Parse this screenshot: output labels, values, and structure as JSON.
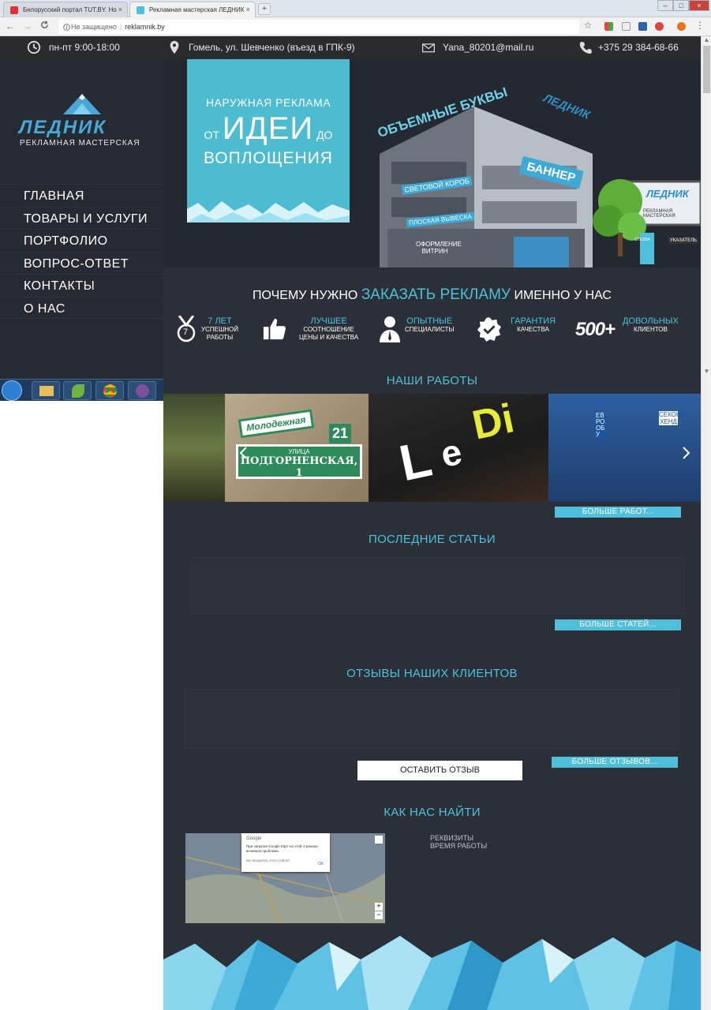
{
  "browser": {
    "tabs": [
      {
        "label": "Белорусский портал TUT.BY. Но",
        "close": "×"
      },
      {
        "label": "Рекламная мастерская ЛЕДНИК",
        "close": "×"
      }
    ],
    "new_tab": "+",
    "nav": {
      "back": "←",
      "forward": "→",
      "reload": "C"
    },
    "address": {
      "security": "Не защищено",
      "url": "reklamnik.by"
    },
    "bookmark_star": "☆",
    "menu_dots": "⋮"
  },
  "topbar": {
    "hours": "пн-пт 9:00-18:00",
    "address": "Гомель, ул. Шевченко (въезд в ГПК-9)",
    "email": "Yana_80201@mail.ru",
    "phone_prefix": "+375 29",
    "phone_number": "384-68-66"
  },
  "logo": {
    "name": "ЛЕДНИК",
    "subtitle": "РЕКЛАМНАЯ МАСТЕРСКАЯ"
  },
  "menu": [
    {
      "label": "ГЛАВНАЯ"
    },
    {
      "label": "ТОВАРЫ И УСЛУГИ"
    },
    {
      "label": "ПОРТФОЛИО"
    },
    {
      "label": "ВОПРОС-ОТВЕТ"
    },
    {
      "label": "КОНТАКТЫ"
    },
    {
      "label": "О НАС"
    }
  ],
  "hero": {
    "line1": "НАРУЖНАЯ РЕКЛАМА",
    "line2_pre": "ОТ",
    "line2_big": "ИДЕИ",
    "line2_post": "ДО",
    "line3": "ВОПЛОЩЕНИЯ",
    "building": {
      "roof_sign": "ОБЪЕМНЫЕ БУКВЫ",
      "brand": "ЛЕДНИК",
      "light_box": "СВЕТОВОЙ КОРОБ",
      "banner": "БАННЕР",
      "flat_sign": "ПЛОСКАЯ ВЫВЕСКА",
      "window": "ОФОРМЛЕНИЕ ВИТРИН",
      "billboard_brand": "ЛЕДНИК",
      "billboard_sub": "РЕКЛАМНАЯ МАСТЕРСКАЯ",
      "stella": "СТЕЛЛА",
      "pointer": "УКАЗАТЕЛЬ"
    }
  },
  "why": {
    "pre": "ПОЧЕМУ НУЖНО",
    "accent": "ЗАКАЗАТЬ РЕКЛАМУ",
    "post": "ИМЕННО У НАС"
  },
  "features": [
    {
      "title": "7 ЛЕТ",
      "sub1": "УСПЕШНОЙ",
      "sub2": "РАБОТЫ",
      "icon": "medal-icon",
      "badge": "7"
    },
    {
      "title": "ЛУЧШЕЕ",
      "sub1": "СООТНОШЕНИЕ",
      "sub2": "ЦЕНЫ И КАЧЕСТВА",
      "icon": "thumbs-up-icon"
    },
    {
      "title": "ОПЫТНЫЕ",
      "sub1": "СПЕЦИАЛИСТЫ",
      "sub2": "",
      "icon": "specialist-icon"
    },
    {
      "title": "ГАРАНТИЯ",
      "sub1": "КАЧЕСТВА",
      "sub2": "",
      "icon": "guarantee-check-icon"
    },
    {
      "title": "ДОВОЛЬНЫХ",
      "sub1": "КЛИЕНТОВ",
      "sub2": "",
      "icon": "count-badge",
      "big": "500+"
    }
  ],
  "works": {
    "title": "НАШИ РАБОТЫ",
    "sign_top": "Молодежная",
    "sign_num": "21",
    "sign_street": "УЛИЦА",
    "sign_name": "ПОДГОРНЕНСКАЯ, 1",
    "ledi_1": "L",
    "ledi_2": "e",
    "ledi_3": "Di",
    "shop_1": "ЕВРООБУ",
    "shop_2": "СЕКОНД ХЕНД",
    "more": "БОЛЬШЕ РАБОТ..."
  },
  "articles": {
    "title": "ПОСЛЕДНИЕ СТАТЬИ",
    "more": "БОЛЬШЕ СТАТЕЙ..."
  },
  "reviews": {
    "title": "ОТЗЫВЫ НАШИХ КЛИЕНТОВ",
    "leave": "ОСТАВИТЬ ОТЗЫВ",
    "more": "БОЛЬШЕ ОТЗЫВОВ..."
  },
  "find": {
    "title": "КАК НАС НАЙТИ",
    "map_dialog_title": "Google",
    "map_dialog_text": "При загрузке Google Карт на этой странице возникла проблема.",
    "map_dialog_link": "Вы владелец этого сайта?",
    "map_dialog_ok": "ОК",
    "zoom_in": "+",
    "zoom_out": "−",
    "requisites": "РЕКВИЗИТЫ",
    "work_time": "ВРЕМЯ РАБОТЫ"
  },
  "colors": {
    "accent": "#4ec0db",
    "sidebar": "#262a33",
    "main": "#2b2f38",
    "topbar": "#2b2b2d"
  }
}
